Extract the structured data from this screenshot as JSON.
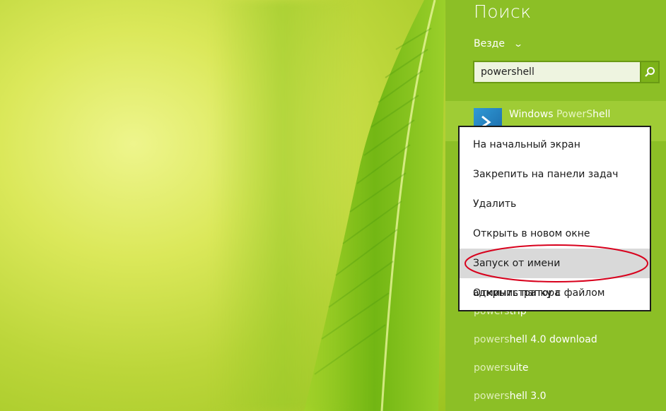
{
  "wallpaper": {
    "description_icon": "green-leaf-wallpaper"
  },
  "search_panel": {
    "title": "Поиск",
    "scope_label": "Везде",
    "query": "powershell",
    "search_button_icon": "search-icon",
    "top_result": {
      "label_prefix": "Windows ",
      "label_highlight": "PowerS",
      "label_suffix": "hell",
      "icon": "powershell-icon"
    },
    "suggestions": [
      {
        "match": "powers",
        "rest": "trip"
      },
      {
        "match": "powers",
        "rest": "hell 4.0 download"
      },
      {
        "match": "powers",
        "rest": "uite"
      },
      {
        "match": "powers",
        "rest": "hell 3.0"
      }
    ]
  },
  "context_menu": {
    "items": [
      "На начальный экран",
      "Закрепить на панели задач",
      "Удалить",
      "Открыть в новом окне",
      "Запуск от имени администратора",
      "Открыть папку с файлом"
    ],
    "highlighted_index": 4
  },
  "colors": {
    "panel": "#8cbf26",
    "result_highlight": "#9fcc35",
    "annotation": "#d8001c"
  }
}
